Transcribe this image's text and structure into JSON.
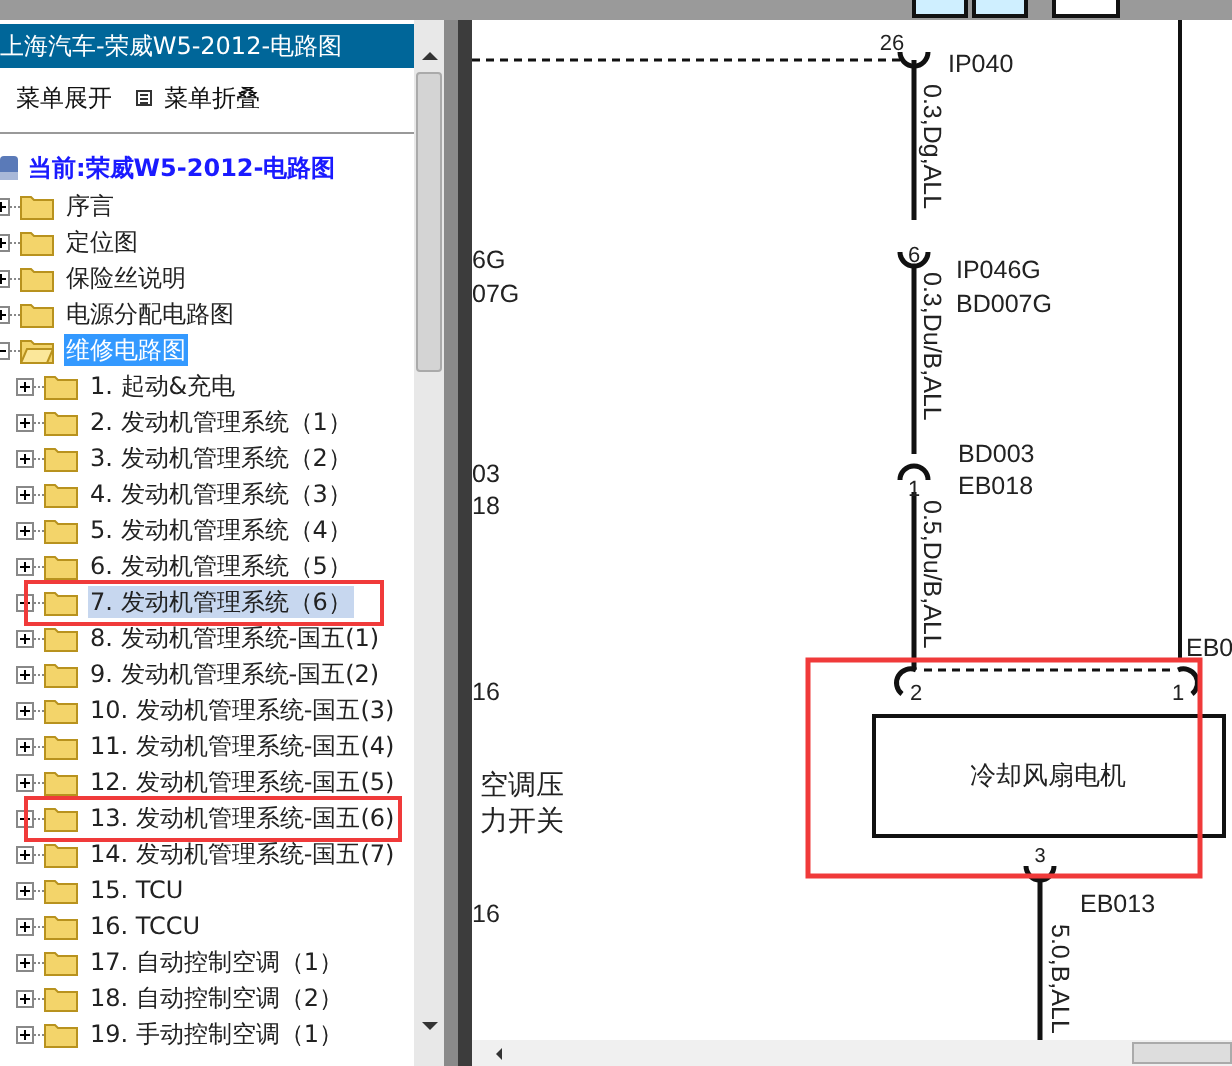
{
  "panel": {
    "title": "上海汽车-荣威W5-2012-电路图"
  },
  "toolbar": [
    {
      "kind": "expand",
      "label": "菜单展开"
    },
    {
      "kind": "collapse",
      "label": "菜单折叠"
    }
  ],
  "tree": {
    "current": "当前:荣威W5-2012-电路图",
    "items": [
      {
        "label": "序言",
        "expanded": false,
        "selected": false,
        "hovered": false,
        "annotated": false
      },
      {
        "label": "定位图",
        "expanded": false,
        "selected": false,
        "hovered": false,
        "annotated": false
      },
      {
        "label": "保险丝说明",
        "expanded": false,
        "selected": false,
        "hovered": false,
        "annotated": false
      },
      {
        "label": "电源分配电路图",
        "expanded": false,
        "selected": false,
        "hovered": false,
        "annotated": false
      },
      {
        "label": "维修电路图",
        "expanded": true,
        "selected": true,
        "hovered": false,
        "annotated": false,
        "children": [
          {
            "label": "1. 起动&充电",
            "expanded": false,
            "selected": false,
            "hovered": false,
            "annotated": false
          },
          {
            "label": "2. 发动机管理系统（1）",
            "expanded": false,
            "selected": false,
            "hovered": false,
            "annotated": false
          },
          {
            "label": "3. 发动机管理系统（2）",
            "expanded": false,
            "selected": false,
            "hovered": false,
            "annotated": false
          },
          {
            "label": "4. 发动机管理系统（3）",
            "expanded": false,
            "selected": false,
            "hovered": false,
            "annotated": false
          },
          {
            "label": "5. 发动机管理系统（4）",
            "expanded": false,
            "selected": false,
            "hovered": false,
            "annotated": false
          },
          {
            "label": "6. 发动机管理系统（5）",
            "expanded": false,
            "selected": false,
            "hovered": false,
            "annotated": false
          },
          {
            "label": "7. 发动机管理系统（6）",
            "expanded": false,
            "selected": false,
            "hovered": true,
            "annotated": true
          },
          {
            "label": "8. 发动机管理系统-国五(1)",
            "expanded": false,
            "selected": false,
            "hovered": false,
            "annotated": false
          },
          {
            "label": "9. 发动机管理系统-国五(2)",
            "expanded": false,
            "selected": false,
            "hovered": false,
            "annotated": false
          },
          {
            "label": "10. 发动机管理系统-国五(3)",
            "expanded": false,
            "selected": false,
            "hovered": false,
            "annotated": false
          },
          {
            "label": "11. 发动机管理系统-国五(4)",
            "expanded": false,
            "selected": false,
            "hovered": false,
            "annotated": false
          },
          {
            "label": "12. 发动机管理系统-国五(5)",
            "expanded": false,
            "selected": false,
            "hovered": false,
            "annotated": false
          },
          {
            "label": "13. 发动机管理系统-国五(6)",
            "expanded": false,
            "selected": false,
            "hovered": false,
            "annotated": true
          },
          {
            "label": "14. 发动机管理系统-国五(7)",
            "expanded": false,
            "selected": false,
            "hovered": false,
            "annotated": false
          },
          {
            "label": "15. TCU",
            "expanded": false,
            "selected": false,
            "hovered": false,
            "annotated": false
          },
          {
            "label": "16. TCCU",
            "expanded": false,
            "selected": false,
            "hovered": false,
            "annotated": false
          },
          {
            "label": "17. 自动控制空调（1）",
            "expanded": false,
            "selected": false,
            "hovered": false,
            "annotated": false
          },
          {
            "label": "18. 自动控制空调（2）",
            "expanded": false,
            "selected": false,
            "hovered": false,
            "annotated": false
          },
          {
            "label": "19. 手动控制空调（1）",
            "expanded": false,
            "selected": false,
            "hovered": false,
            "annotated": false
          }
        ]
      }
    ]
  },
  "diagram": {
    "connectors": [
      {
        "pin": "26",
        "codes": [
          "IP040"
        ]
      },
      {
        "pin": "6",
        "codes": [
          "IP046G",
          "BD007G"
        ]
      },
      {
        "pin": "1",
        "codes": [
          "BD003",
          "EB018"
        ]
      },
      {
        "pin": "2"
      },
      {
        "pin": "1",
        "codes": [
          "EB0"
        ]
      },
      {
        "pin": "3",
        "codes": [
          "EB013"
        ]
      }
    ],
    "wires": [
      "0.3,Dg,ALL",
      "0.3,Du/B,ALL",
      "0.5,Du/B,ALL",
      "5.0,B,ALL"
    ],
    "component": {
      "label": "冷却风扇电机",
      "annotated": true
    },
    "side_labels": [
      "6G",
      "07G",
      "03",
      "18",
      "16",
      "空调压",
      "力开关",
      "16"
    ]
  }
}
